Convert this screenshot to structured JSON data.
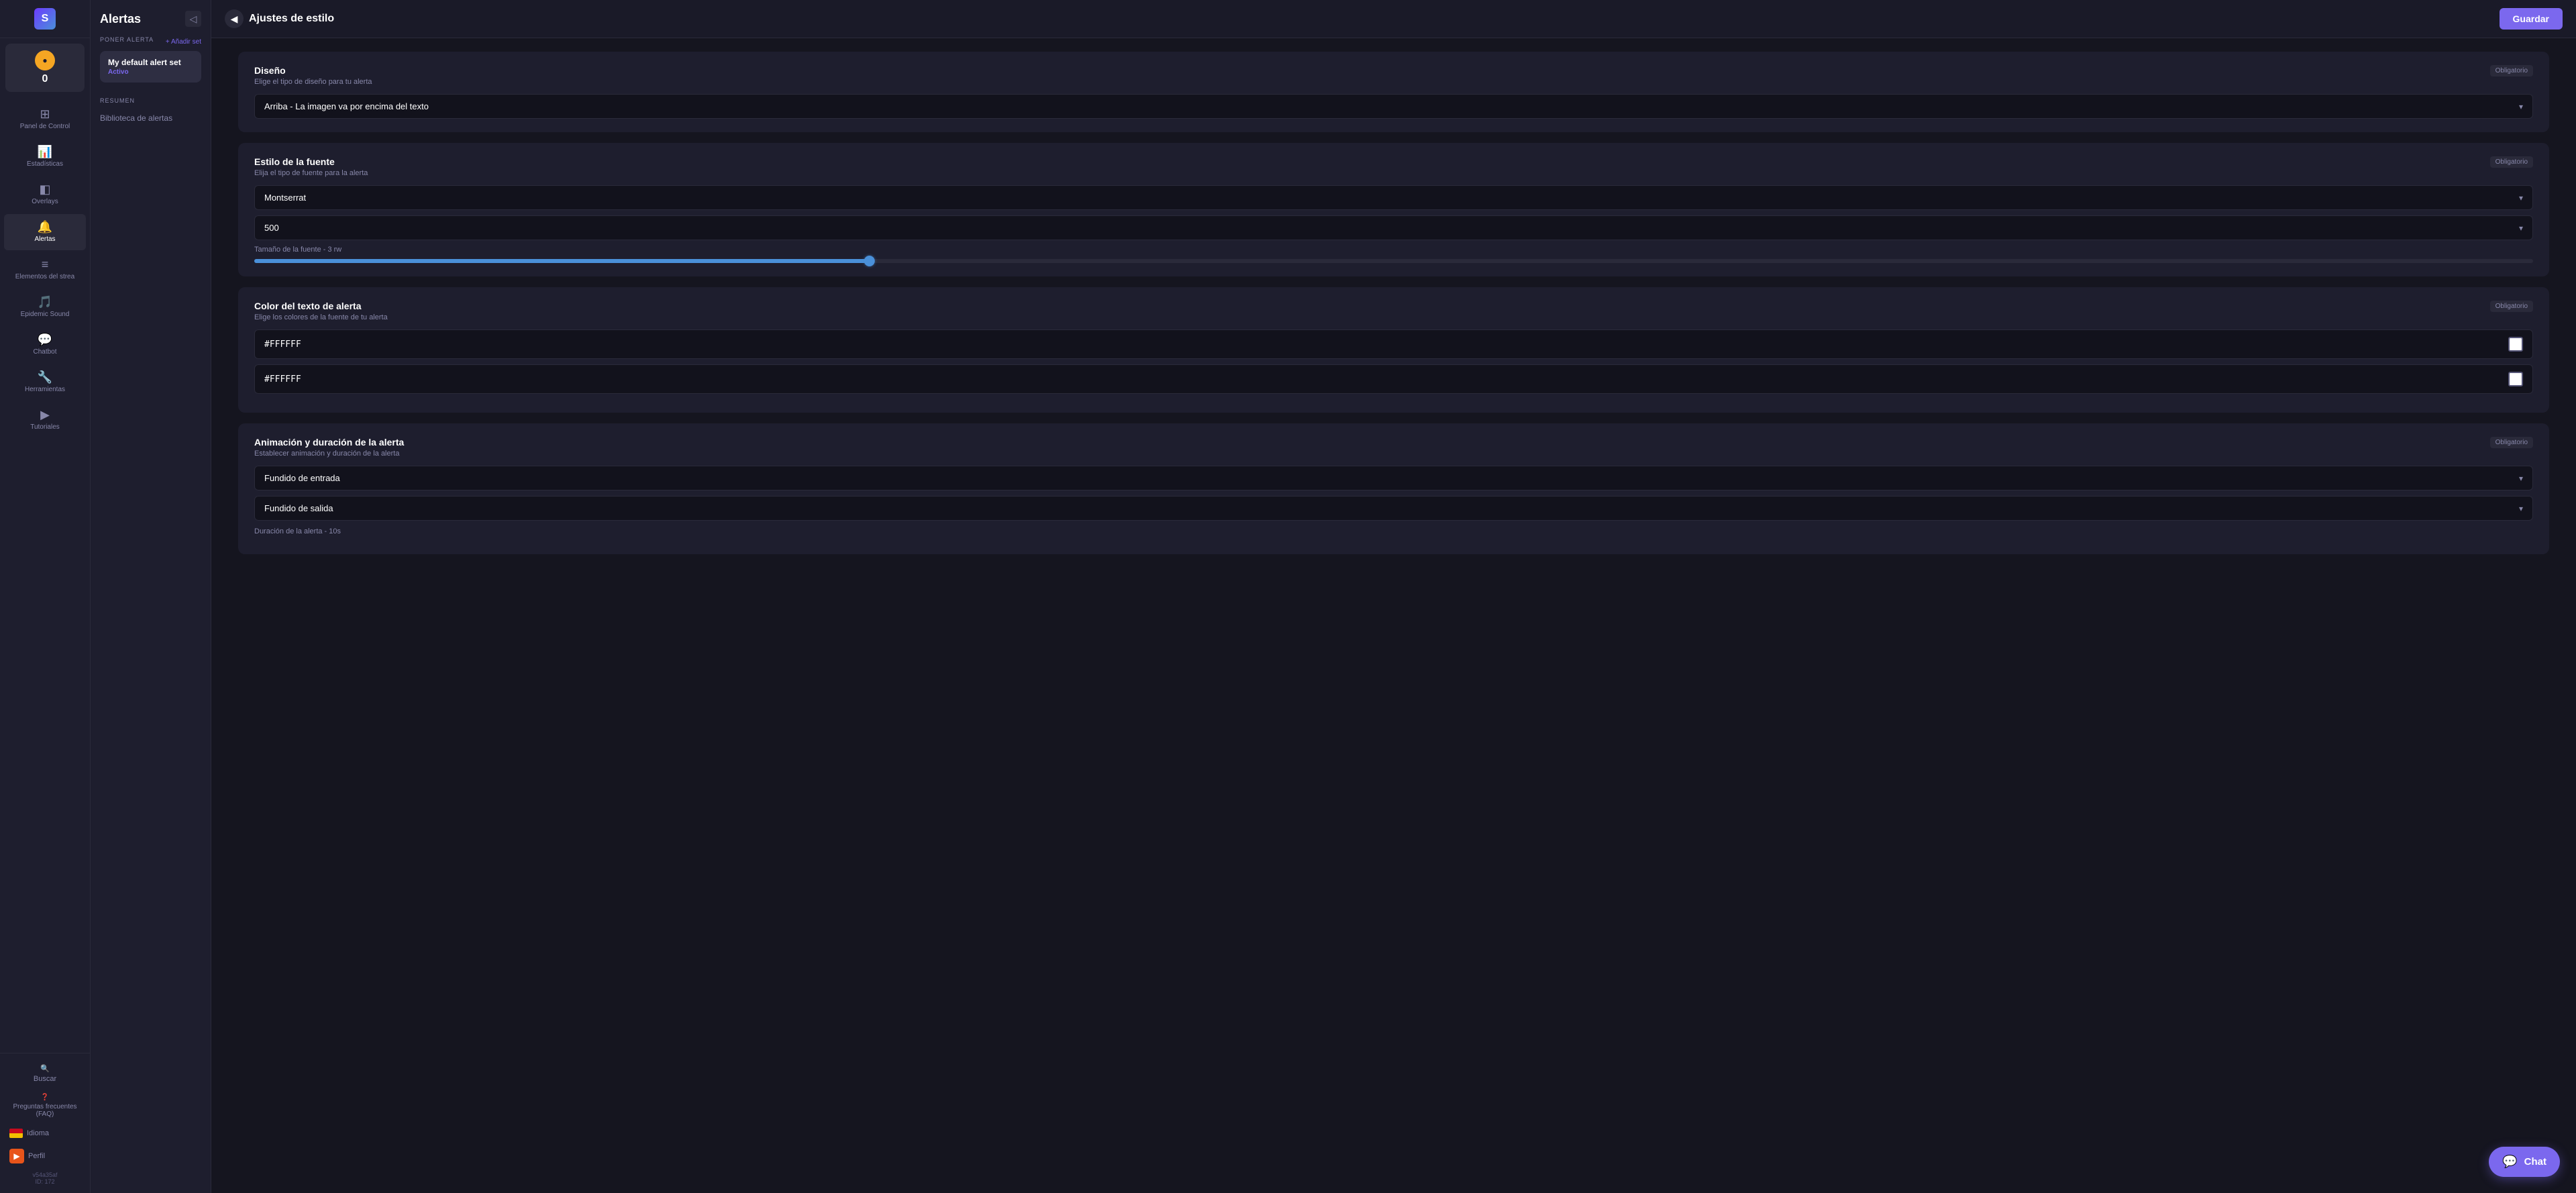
{
  "app": {
    "logo": "S",
    "score": "0"
  },
  "sidebar": {
    "items": [
      {
        "id": "panel",
        "icon": "⊞",
        "label": "Panel de Control"
      },
      {
        "id": "estadisticas",
        "icon": "📊",
        "label": "Estadísticas"
      },
      {
        "id": "overlays",
        "icon": "◧",
        "label": "Overlays"
      },
      {
        "id": "alertas",
        "icon": "🔔",
        "label": "Alertas",
        "active": true
      },
      {
        "id": "elementos",
        "icon": "≡",
        "label": "Elementos del strea"
      },
      {
        "id": "epidemic",
        "icon": "🎵",
        "label": "Epidemic Sound"
      },
      {
        "id": "chatbot",
        "icon": "💬",
        "label": "Chatbot"
      },
      {
        "id": "herramientas",
        "icon": "🔧",
        "label": "Herramientas"
      },
      {
        "id": "tutoriales",
        "icon": "▶",
        "label": "Tutoriales"
      }
    ],
    "search_label": "Buscar",
    "faq_label": "Preguntas frecuentes (FAQ)",
    "lang_label": "Idioma",
    "profile_label": "Perfil",
    "version": "v54a35af",
    "id_label": "ID: 172"
  },
  "alerts_panel": {
    "title": "Alertas",
    "collapse_icon": "◁",
    "section_label": "PONER ALERTA",
    "add_set_label": "+ Añadir set",
    "alert_set": {
      "name": "My default alert set",
      "badge": "Activo"
    },
    "resumen_label": "RESUMEN",
    "biblioteca_label": "Biblioteca de alertas"
  },
  "main": {
    "back_icon": "◀",
    "page_title": "Ajustes de estilo",
    "save_button": "Guardar",
    "sections": [
      {
        "id": "diseno",
        "title": "Diseño",
        "subtitle": "Elige el tipo de diseño para tu alerta",
        "badge": "Obligatorio",
        "fields": [
          {
            "type": "select",
            "value": "Arriba - La imagen va por encima del texto"
          }
        ]
      },
      {
        "id": "estilo-fuente",
        "title": "Estilo de la fuente",
        "subtitle": "Elija el tipo de fuente para la alerta",
        "badge": "Obligatorio",
        "fields": [
          {
            "type": "select",
            "value": "Montserrat"
          },
          {
            "type": "select",
            "value": "500"
          }
        ],
        "slider": {
          "label": "Tamaño de la fuente - 3 rw",
          "fill_percent": 27,
          "thumb_percent": 27
        }
      },
      {
        "id": "color-texto",
        "title": "Color del texto de alerta",
        "subtitle": "Elige los colores de la fuente de tu alerta",
        "badge": "Obligatorio",
        "colors": [
          {
            "value": "#FFFFFF",
            "swatch": "#FFFFFF"
          },
          {
            "value": "#FFFFFF",
            "swatch": "#FFFFFF"
          }
        ]
      },
      {
        "id": "animacion",
        "title": "Animación y duración de la alerta",
        "subtitle": "Establecer animación y duración de la alerta",
        "badge": "Obligatorio",
        "fields": [
          {
            "type": "select",
            "value": "Fundido de entrada"
          },
          {
            "type": "select",
            "value": "Fundido de salida"
          }
        ],
        "duration_label": "Duración de la alerta - 10s"
      }
    ]
  },
  "chat": {
    "icon": "💬",
    "label": "Chat"
  }
}
